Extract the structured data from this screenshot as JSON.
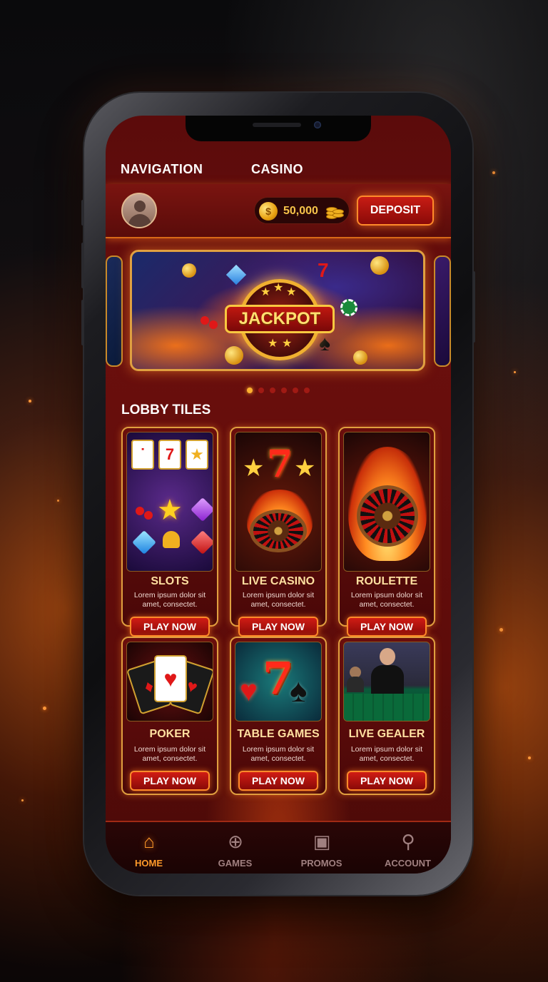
{
  "topnav": {
    "left": "NAVIGATION",
    "right": "CASINO"
  },
  "header": {
    "balance": "50,000",
    "deposit_label": "DEPOSIT",
    "coin_icon": "coin-icon",
    "avatar_icon": "user-avatar-icon"
  },
  "banner": {
    "title": "JACKPOT",
    "slides": 6,
    "active_slide": 1
  },
  "lobby": {
    "title": "LOBBY TILES",
    "tiles": [
      {
        "name": "SLOTS",
        "desc": "Lorem ipsum dolor sit amet, consectet.",
        "cta": "PLAY NOW"
      },
      {
        "name": "LIVE CASINO",
        "desc": "Lorem ipsum dolor sit amet, consectet.",
        "cta": "PLAY NOW"
      },
      {
        "name": "ROULETTE",
        "desc": "Lorem ipsum dolor sit amet, consectet.",
        "cta": "PLAY NOW"
      },
      {
        "name": "POKER",
        "desc": "Lorem ipsum dolor sit amet, consectet.",
        "cta": "PLAY NOW"
      },
      {
        "name": "TABLE GAMES",
        "desc": "Lorem ipsum dolor sit amet, consectet.",
        "cta": "PLAY NOW"
      },
      {
        "name": "LIVE GEALER",
        "desc": "Lorem ipsum dolor sit amet, consectet.",
        "cta": "PLAY NOW"
      }
    ]
  },
  "tabbar": {
    "items": [
      {
        "label": "HOME",
        "icon": "home-icon",
        "active": true
      },
      {
        "label": "GAMES",
        "icon": "gamepad-icon",
        "active": false
      },
      {
        "label": "PROMOS",
        "icon": "gift-icon",
        "active": false
      },
      {
        "label": "ACCOUNT",
        "icon": "user-icon",
        "active": false
      }
    ]
  },
  "colors": {
    "accent": "#ff9a2a",
    "primary_red": "#c81c14",
    "gold": "#f6c44a",
    "background": "#5e0c0a"
  }
}
